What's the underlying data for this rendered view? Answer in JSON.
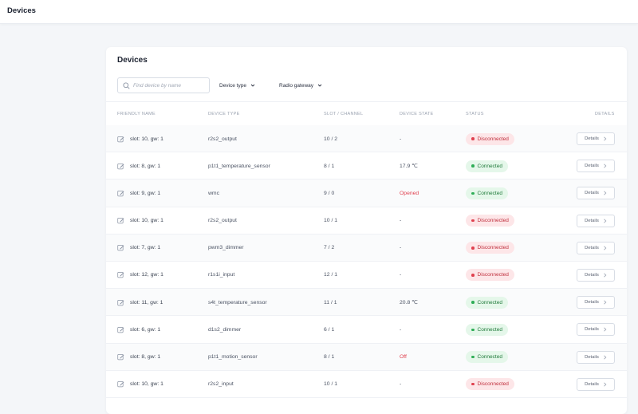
{
  "topbar": {
    "title": "Devices"
  },
  "card": {
    "title": "Devices",
    "search": {
      "placeholder": "Find device by name",
      "value": ""
    },
    "filters": [
      {
        "label": "Device type"
      },
      {
        "label": "Radio gateway"
      }
    ]
  },
  "table": {
    "headers": {
      "friendly_name": "FRIENDLY NAME",
      "device_type": "DEVICE TYPE",
      "slot_channel": "SLOT / CHANNEL",
      "device_state": "DEVICE STATE",
      "status": "STATUS",
      "details": "DETAILS"
    },
    "details_label": "Details",
    "rows": [
      {
        "name": "slot: 10, gw: 1",
        "type": "r2s2_output",
        "slot": "10 / 2",
        "state": "-",
        "state_alert": false,
        "status": "Disconnected"
      },
      {
        "name": "slot: 8, gw: 1",
        "type": "p1t1_temperature_sensor",
        "slot": "8 / 1",
        "state": "17.9 ℃",
        "state_alert": false,
        "status": "Connected"
      },
      {
        "name": "slot: 9, gw: 1",
        "type": "wmc",
        "slot": "9 / 0",
        "state": "Opened",
        "state_alert": true,
        "status": "Connected"
      },
      {
        "name": "slot: 10, gw: 1",
        "type": "r2s2_output",
        "slot": "10 / 1",
        "state": "-",
        "state_alert": false,
        "status": "Disconnected"
      },
      {
        "name": "slot: 7, gw: 1",
        "type": "pwm3_dimmer",
        "slot": "7 / 2",
        "state": "-",
        "state_alert": false,
        "status": "Disconnected"
      },
      {
        "name": "slot: 12, gw: 1",
        "type": "r1s1i_input",
        "slot": "12 / 1",
        "state": "-",
        "state_alert": false,
        "status": "Disconnected"
      },
      {
        "name": "slot: 11, gw: 1",
        "type": "s4t_temperature_sensor",
        "slot": "11 / 1",
        "state": "20.8 ℃",
        "state_alert": false,
        "status": "Connected"
      },
      {
        "name": "slot: 6, gw: 1",
        "type": "d1s2_dimmer",
        "slot": "6 / 1",
        "state": "-",
        "state_alert": false,
        "status": "Connected"
      },
      {
        "name": "slot: 8, gw: 1",
        "type": "p1t1_motion_sensor",
        "slot": "8 / 1",
        "state": "Off",
        "state_alert": true,
        "status": "Connected"
      },
      {
        "name": "slot: 10, gw: 1",
        "type": "r2s2_input",
        "slot": "10 / 1",
        "state": "-",
        "state_alert": false,
        "status": "Disconnected"
      }
    ]
  },
  "colors": {
    "alert_text": "#e0414f",
    "connected_bg": "#e5f7ea",
    "disconnected_bg": "#fde6e8"
  },
  "icons": {
    "search": "search-icon",
    "edit": "edit-icon",
    "chevron_down": "chevron-down-icon",
    "chevron_right": "chevron-right-icon"
  }
}
